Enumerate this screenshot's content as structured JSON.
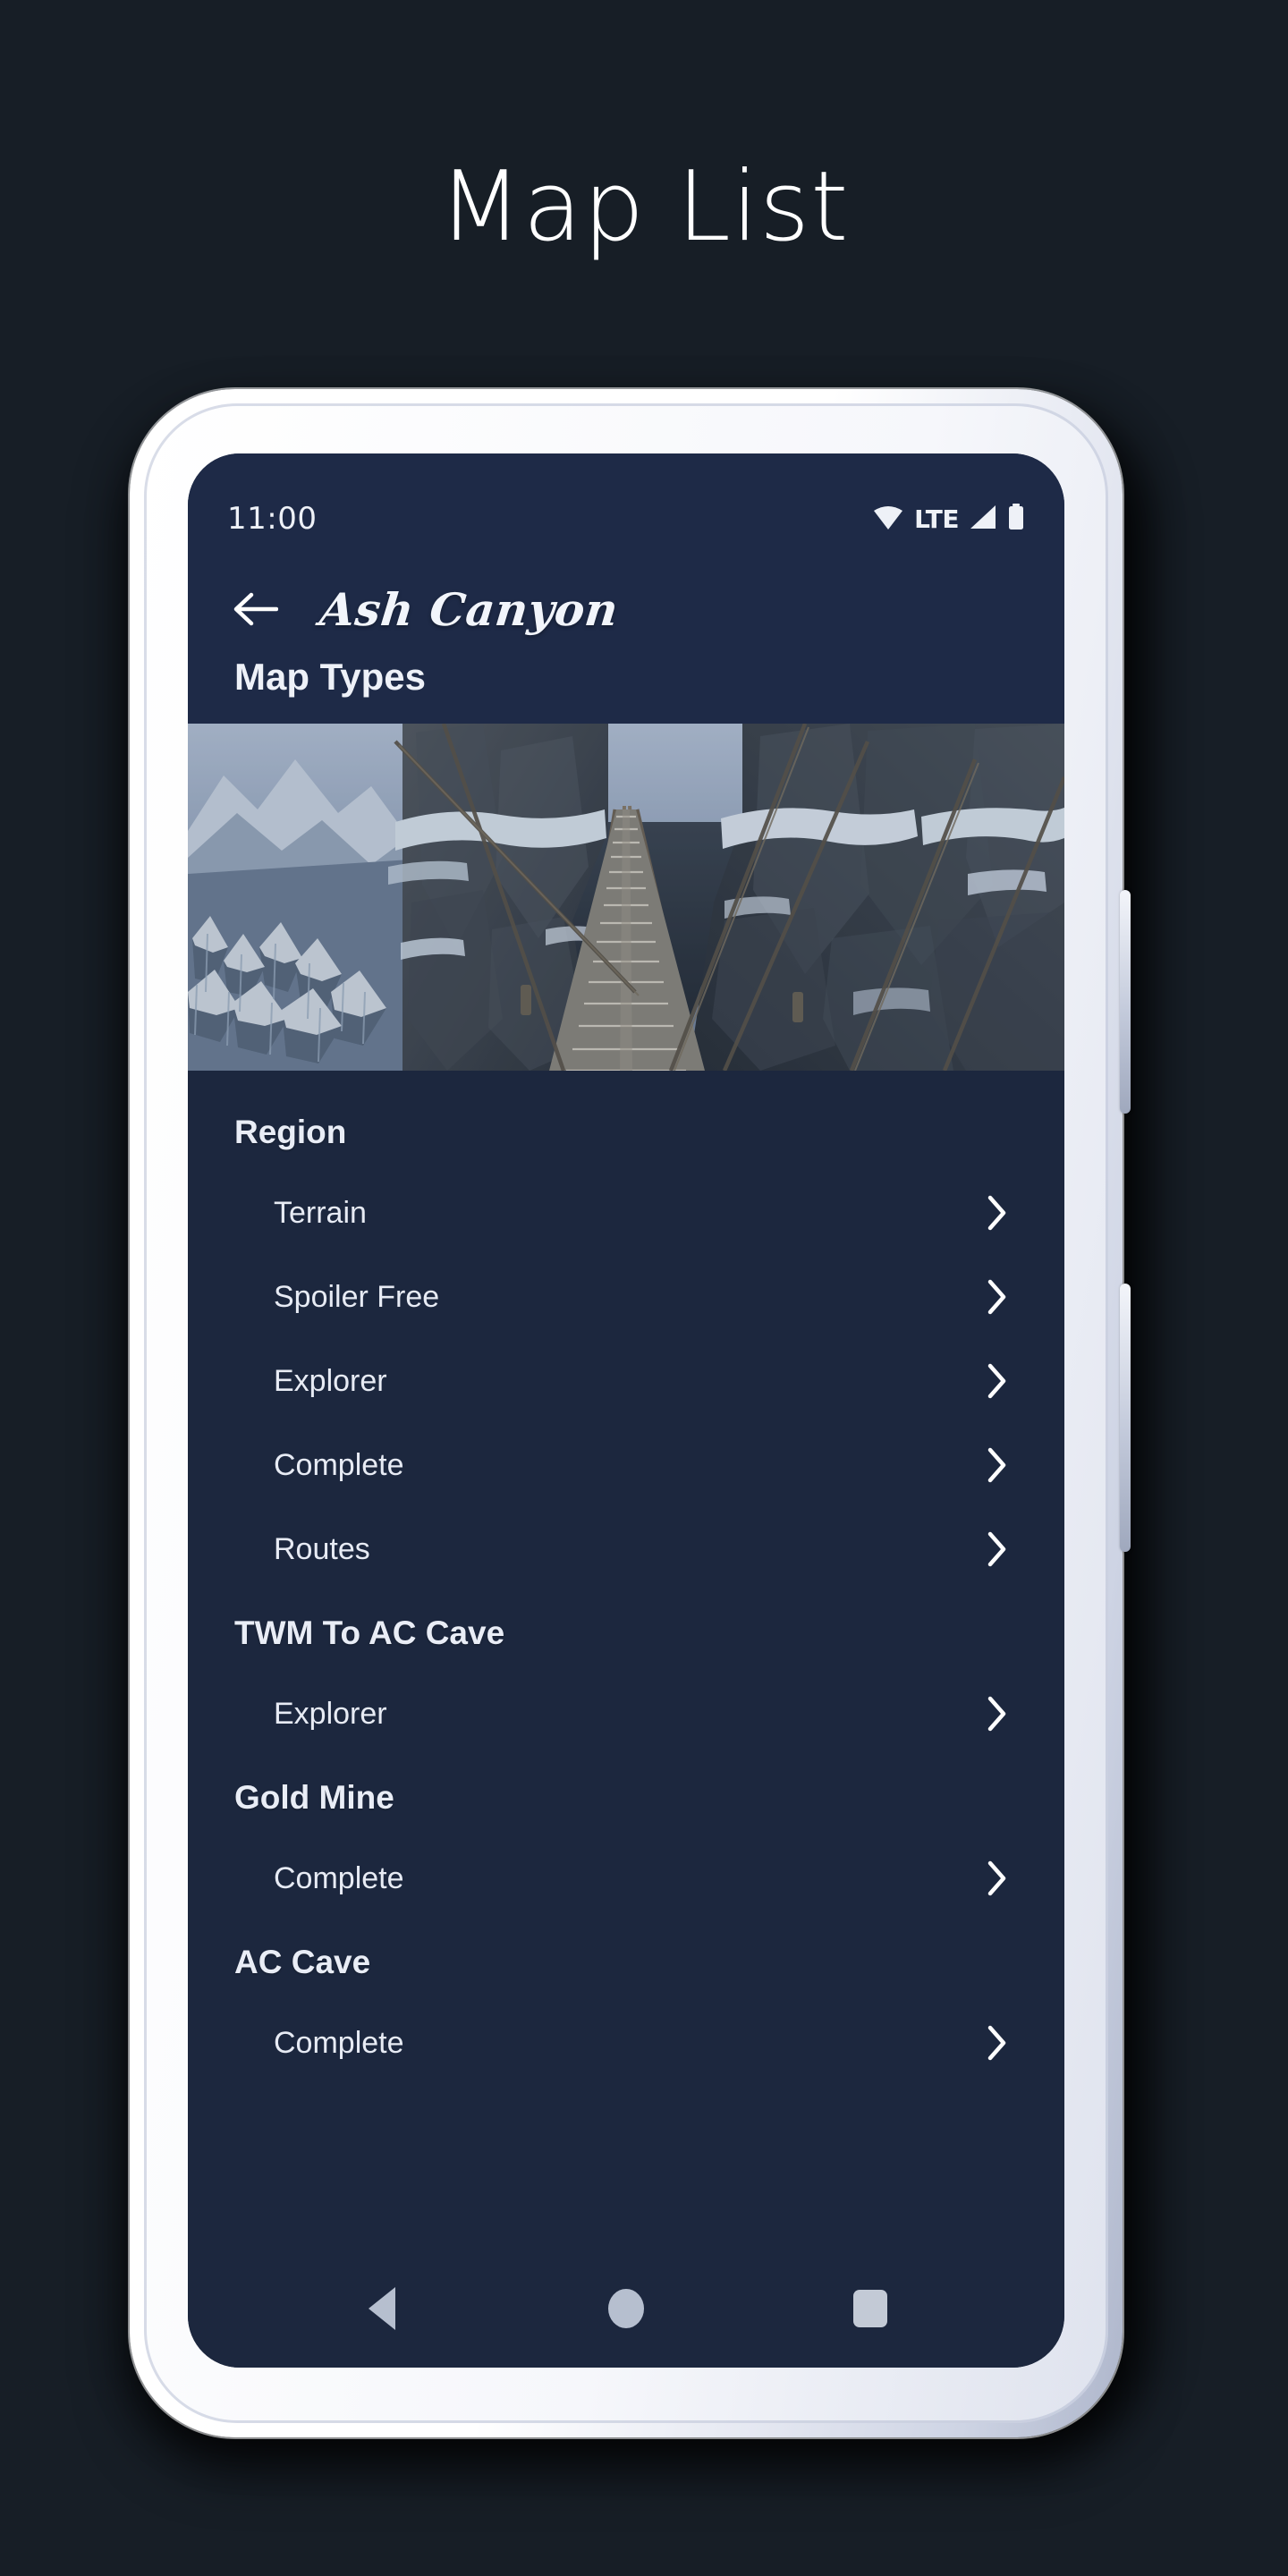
{
  "page": {
    "title": "Map List",
    "background_color": "#171e26"
  },
  "phone": {
    "frame_color": "#ffffff",
    "side_buttons": [
      "power-button",
      "volume-button"
    ]
  },
  "statusbar": {
    "time": "11:00",
    "lte_label": "LTE",
    "icons": [
      "wifi-icon",
      "lte-label",
      "signal-icon",
      "battery-icon"
    ],
    "background_color": "#1e2a47"
  },
  "appbar": {
    "back_icon": "arrow-left-icon",
    "title": "Ash Canyon",
    "subtitle": "Map Types",
    "background_color": "#1e2a47"
  },
  "hero": {
    "alt": "Snowy canyon rope bridge"
  },
  "list": {
    "background_color": "#1c273e",
    "chevron_icon": "chevron-right-icon",
    "sections": [
      {
        "header": "Region",
        "items": [
          {
            "label": "Terrain"
          },
          {
            "label": "Spoiler Free"
          },
          {
            "label": "Explorer"
          },
          {
            "label": "Complete"
          },
          {
            "label": "Routes"
          }
        ]
      },
      {
        "header": "TWM To AC Cave",
        "items": [
          {
            "label": "Explorer"
          }
        ]
      },
      {
        "header": "Gold Mine",
        "items": [
          {
            "label": "Complete"
          }
        ]
      },
      {
        "header": "AC Cave",
        "items": [
          {
            "label": "Complete"
          }
        ]
      }
    ]
  },
  "navbar": {
    "back_label": "back-button",
    "home_label": "home-button",
    "recents_label": "recents-button",
    "icon_color": "#b6bfcf"
  }
}
